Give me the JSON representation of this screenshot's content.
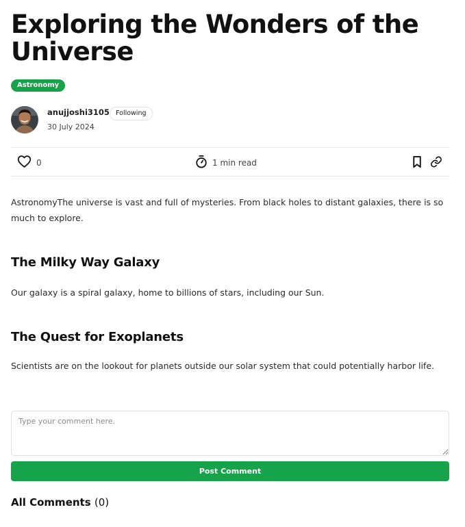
{
  "article": {
    "title": "Exploring the Wonders of the Universe",
    "category": "Astronomy"
  },
  "author": {
    "username": "anujjoshi3105",
    "follow_label": "Following",
    "date": "30 July 2024"
  },
  "actions": {
    "like_count": "0",
    "read_time": "1 min read",
    "icons": [
      "heart-icon",
      "stopwatch-icon",
      "bookmark-icon",
      "link-icon"
    ]
  },
  "body": {
    "intro": "AstronomyThe universe is vast and full of mysteries. From black holes to distant galaxies, there is so much to explore.",
    "sections": [
      {
        "heading": "The Milky Way Galaxy",
        "text": "Our galaxy is a spiral galaxy, home to billions of stars, including our Sun."
      },
      {
        "heading": "The Quest for Exoplanets",
        "text": "Scientists are on the lookout for planets outside our solar system that could potentially harbor life."
      }
    ]
  },
  "comments": {
    "placeholder": "Type your comment here.",
    "value": "",
    "submit_label": "Post Comment",
    "header_label": "All Comments",
    "header_count": "(0)"
  },
  "colors": {
    "accent": "#16a34a"
  }
}
